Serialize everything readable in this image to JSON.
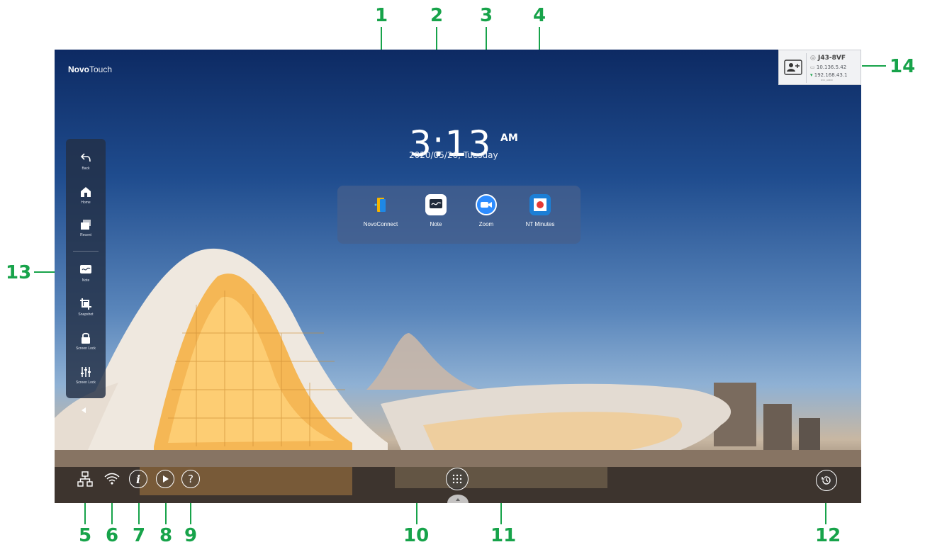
{
  "screen": {
    "brand_bold": "Novo",
    "brand_light": "Touch",
    "time": "3:13",
    "ampm": "AM",
    "date": "2020/05/26, Tuesday"
  },
  "apps": [
    {
      "label": "NovoConnect",
      "icon": "novoconnect-icon"
    },
    {
      "label": "Note",
      "icon": "note-icon"
    },
    {
      "label": "Zoom",
      "icon": "zoom-icon"
    },
    {
      "label": "NT Minutes",
      "icon": "nt-minutes-icon"
    }
  ],
  "sidebar": {
    "items": [
      {
        "label": "Back",
        "icon": "back-icon"
      },
      {
        "label": "Home",
        "icon": "home-icon"
      },
      {
        "label": "Recent",
        "icon": "recent-icon"
      },
      {
        "label": "Note",
        "icon": "note-icon"
      },
      {
        "label": "Snapshot",
        "icon": "snapshot-icon"
      },
      {
        "label": "Screen Lock",
        "icon": "lock-icon"
      },
      {
        "label": "Screen Lock",
        "icon": "sliders-icon"
      }
    ]
  },
  "device_info": {
    "code": "J43-8VF",
    "ip_lan": "10.136.5.42",
    "ip_wifi": "192.168.43.1",
    "ssid": "NVC_A0463"
  },
  "callouts": [
    "1",
    "2",
    "3",
    "4",
    "5",
    "6",
    "7",
    "8",
    "9",
    "10",
    "11",
    "12",
    "13",
    "14"
  ],
  "colors": {
    "callout": "#17a34a",
    "nt_minutes_red": "#e53935",
    "zoom_blue": "#2d8cff"
  }
}
